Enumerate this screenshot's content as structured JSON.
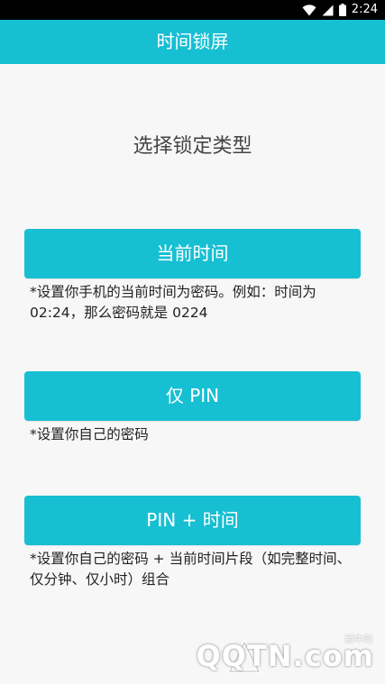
{
  "status_bar": {
    "time": "2:24",
    "icons": [
      "wifi-icon",
      "signal-icon",
      "battery-icon"
    ]
  },
  "app_bar": {
    "title": "时间锁屏"
  },
  "main": {
    "heading": "选择锁定类型",
    "options": [
      {
        "label": "当前时间",
        "description": "*设置你手机的当前时间为密码。例如：时间为 02:24，那么密码就是 0224"
      },
      {
        "label": "仅 PIN",
        "description": "*设置你自己的密码"
      },
      {
        "label": "PIN + 时间",
        "description": "*设置你自己的密码 + 当前时间片段（如完整时间、仅分钟、仅小时）组合"
      }
    ]
  },
  "watermark": {
    "text": "QQTN.com",
    "small": "腾牛网"
  },
  "colors": {
    "accent": "#17bfd3",
    "background": "#f7f7f7",
    "status_bar": "#000000"
  }
}
